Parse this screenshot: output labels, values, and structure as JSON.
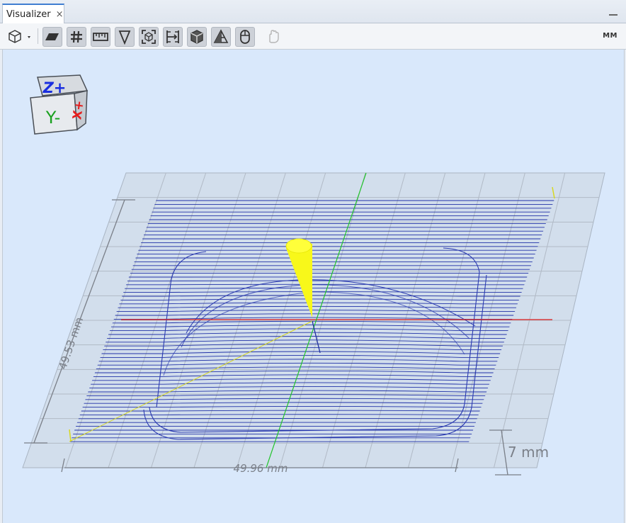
{
  "tab": {
    "title": "Visualizer",
    "close_glyph": "×"
  },
  "toolbar": {
    "units_label": "MM",
    "buttons": [
      {
        "name": "view-cube-menu-icon"
      },
      {
        "name": "toggle-plane-icon"
      },
      {
        "name": "toggle-grid-icon"
      },
      {
        "name": "toggle-ruler-icon"
      },
      {
        "name": "toggle-tool-icon"
      },
      {
        "name": "fit-view-icon"
      },
      {
        "name": "bounds-icon"
      },
      {
        "name": "box-view-icon"
      },
      {
        "name": "toggle-mesh-icon"
      },
      {
        "name": "mouse-icon"
      },
      {
        "name": "jog-disabled-icon"
      }
    ]
  },
  "orientation_cube": {
    "top": "Z+",
    "front": "Y-",
    "right": "X+"
  },
  "dimensions": {
    "y_length": "49.53 mm",
    "x_length": "49.96 mm",
    "z_height": "7 mm"
  },
  "colors": {
    "toolpath": "#2233a8",
    "x_axis": "#e01d1d",
    "y_axis": "#22c42b",
    "tool": "#f5f518",
    "background": "#d9e8fb"
  }
}
